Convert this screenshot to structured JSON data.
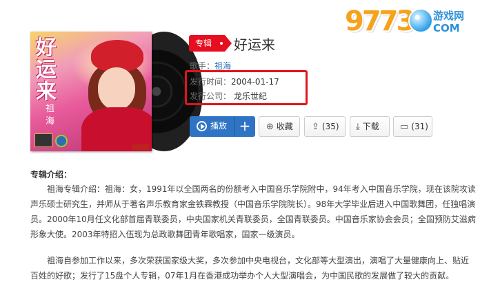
{
  "album": {
    "tag": "专辑",
    "title": "好运来",
    "cover_title": "好运来",
    "cover_artist": "祖海"
  },
  "meta": {
    "singer_label": "歌手：",
    "singer": "祖海",
    "date_label": "发行时间：",
    "date": "2004-01-17",
    "company_label": "发行公司：",
    "company": "龙乐世纪"
  },
  "actions": {
    "play": "播放",
    "add": "+",
    "collect": "收藏",
    "share_count": "(35)",
    "download": "下载",
    "comment_count": "(31)"
  },
  "intro": {
    "heading": "专辑介绍：",
    "paragraph1": "祖海专辑介绍：祖海：女，1991年以全国两名的份额考入中国音乐学院附中，94年考入中国音乐学院，现在该院攻读声乐硕士研究生，并师从于著名声乐教育家金铁霖教授（中国音乐学院院长）。98年大学毕业后进入中国歌舞团，任独唱演员。2000年10月任文化部首届青联委员，中央国家机关青联委员，全国青联委员。中国音乐家协会会员；全国预防艾滋病形象大使。2003年特招入伍现为总政歌舞团青年歌唱家，国家一级演员。",
    "paragraph2": "祖海自参加工作以来，多次荣获国家级大奖，多次参加中央电视台，文化部等大型演出，演唱了大量健康向上、贴近百姓的好歌；发行了15盘个人专辑，07年1月在香港成功举办个人大型演唱会，为中国民歌的发展做了较大的贡献。"
  },
  "watermark": {
    "number": "9773",
    "cn": "游戏网",
    "domain": "COM"
  },
  "colors": {
    "accent_red": "#e60e1f",
    "play_blue": "#2f74c4",
    "link_blue": "#2b6cb0"
  }
}
